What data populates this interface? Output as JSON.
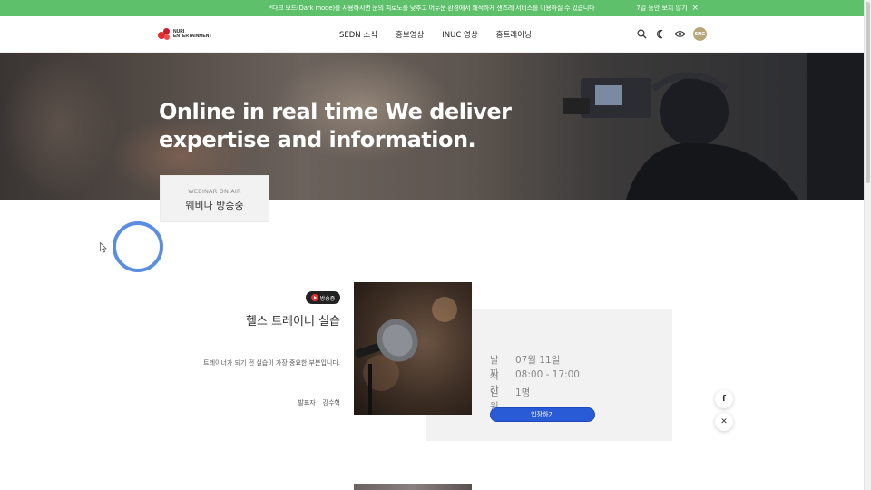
{
  "notice": {
    "text": "*다크 모드(Dark mode)를 사용하시면 눈의 피로도를 낮추고 어두운 환경에서 쾌적하게 샌즈레 서비스를 이용하실 수 있습니다",
    "hide_label": "7일 동안 보지 않기",
    "close_icon": "close-icon",
    "bg_color": "#5ec06a"
  },
  "header": {
    "logo_line1": "NURI",
    "logo_line2": "ENTERTAINMENT",
    "nav": [
      "SEDN 소식",
      "홍보영상",
      "INUC 영상",
      "홈트레이닝"
    ],
    "icons": [
      "search-icon",
      "moon-icon",
      "eye-icon"
    ],
    "lang_label": "ENG"
  },
  "hero": {
    "title_line1": "Online in real time We deliver",
    "title_line2": "expertise and information."
  },
  "webinar_tab": {
    "sub": "WEBINAR ON AIR",
    "main": "웨비나 방송중"
  },
  "session": {
    "badge": "방송중",
    "title": "헬스 트레이너 실습",
    "description": "트레이너가 되기 전 실습이 가장 중요한 부분입니다.",
    "presenter_label": "발표자",
    "presenter_name": "강수혁",
    "info": [
      {
        "key": "날짜",
        "value": "07월 11일"
      },
      {
        "key": "시간",
        "value": "08:00 - 17:00"
      },
      {
        "key": "인원",
        "value": "1명"
      }
    ],
    "enter_label": "입장하기",
    "accent_color": "#2a5bd7"
  },
  "floating": {
    "facebook_label": "f",
    "close_label": "✕"
  }
}
